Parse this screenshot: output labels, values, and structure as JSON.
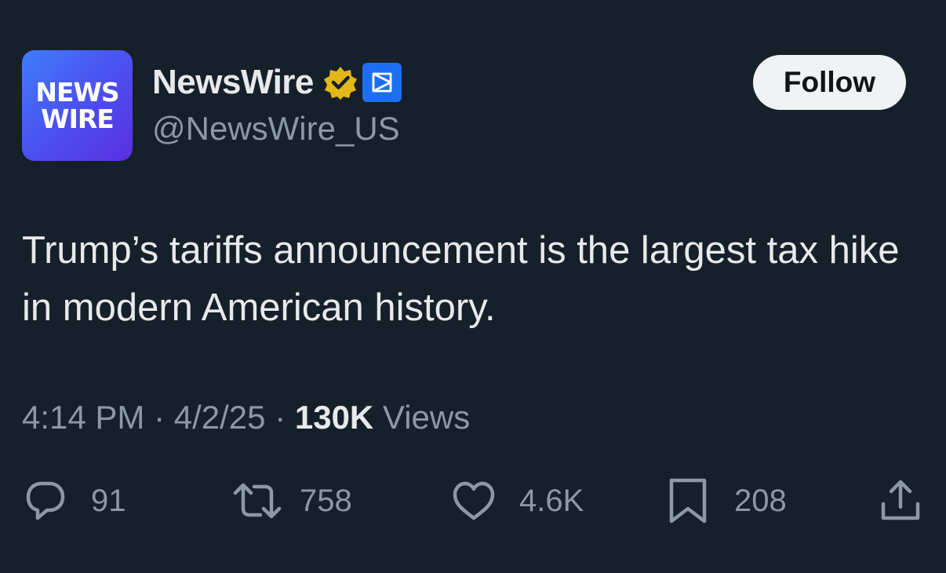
{
  "author": {
    "avatar_text_line1": "NEWS",
    "avatar_text_line2": "WIRE",
    "name": "NewsWire",
    "handle": "@NewsWire_US",
    "verified_icon": "gold-verified-badge-icon",
    "affiliation_icon": "affiliate-badge-icon"
  },
  "follow_label": "Follow",
  "tweet": {
    "text": "Trump’s tariffs announcement is the largest tax hike in modern American history."
  },
  "meta": {
    "time": "4:14 PM",
    "sep1": " · ",
    "date": "4/2/25",
    "sep2": " · ",
    "views_count": "130K",
    "views_label": " Views"
  },
  "actions": {
    "replies": "91",
    "reposts": "758",
    "likes": "4.6K",
    "bookmarks": "208"
  },
  "colors": {
    "background": "#16202b",
    "primary_text": "#e7e9ea",
    "secondary_text": "#8b98a5",
    "verified_gold": "#e2b719",
    "affiliate_blue": "#1d6ff2",
    "follow_bg": "#eff3f4"
  }
}
